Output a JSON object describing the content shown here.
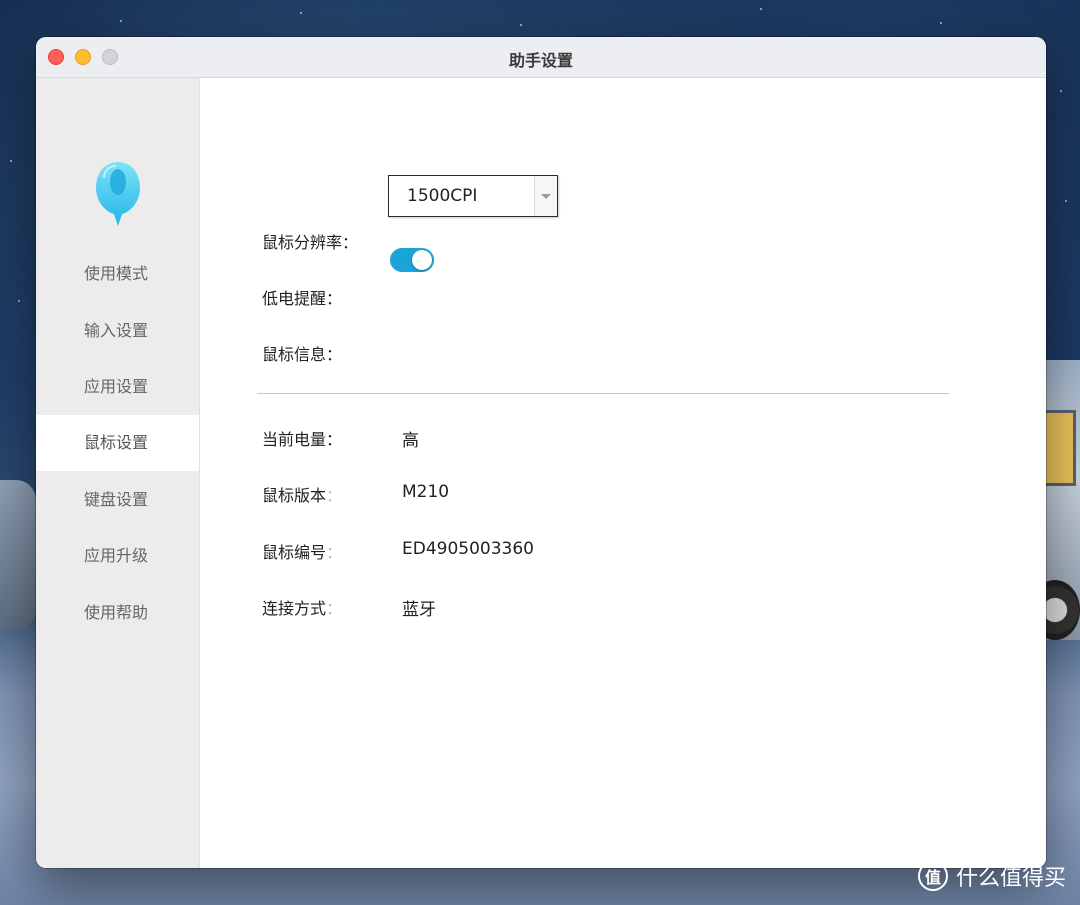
{
  "window": {
    "title": "助手设置"
  },
  "sidebar": {
    "items": [
      {
        "label": "使用模式",
        "active": false
      },
      {
        "label": "输入设置",
        "active": false
      },
      {
        "label": "应用设置",
        "active": false
      },
      {
        "label": "鼠标设置",
        "active": true
      },
      {
        "label": "键盘设置",
        "active": false
      },
      {
        "label": "应用升级",
        "active": false
      },
      {
        "label": "使用帮助",
        "active": false
      }
    ]
  },
  "settings": {
    "dpi_label": "鼠标分辨率",
    "dpi_value": "1500CPI",
    "low_battery_label": "低电提醒",
    "low_battery_enabled": true,
    "mouse_info_label": "鼠标信息"
  },
  "info": {
    "battery_label": "当前电量",
    "battery_value": "高",
    "version_label": "鼠标版本",
    "version_value": "M210",
    "serial_label": "鼠标编号",
    "serial_value": "ED4905003360",
    "connection_label": "连接方式",
    "connection_value": "蓝牙"
  },
  "colon": "：",
  "watermark": {
    "icon_text": "值",
    "text": "什么值得买"
  },
  "colors": {
    "toggle_on": "#1ba4d8",
    "sidebar_bg": "#ececec",
    "logo_primary": "#36c6f0"
  }
}
